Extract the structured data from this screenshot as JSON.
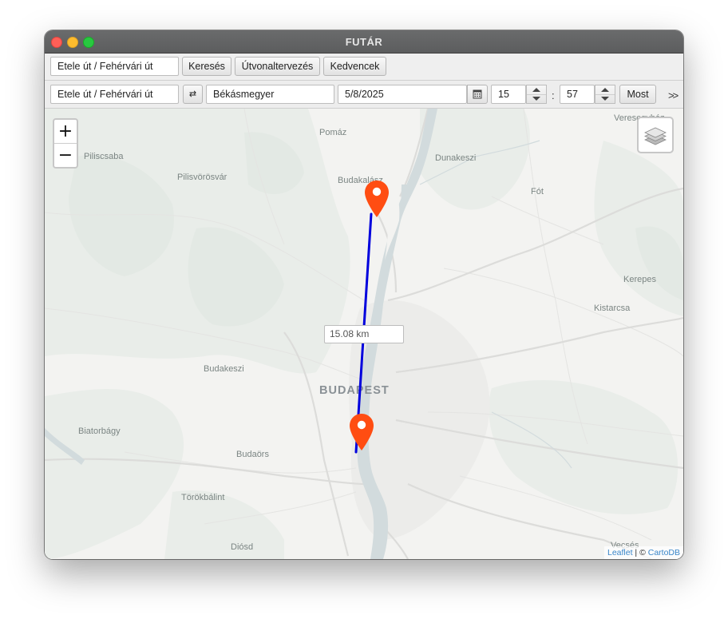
{
  "window": {
    "title": "FUTÁR"
  },
  "toolbar1": {
    "search_value": "Etele út / Fehérvári út",
    "search_button": "Keresés",
    "route_button": "Útvonaltervezés",
    "favorites_button": "Kedvencek"
  },
  "toolbar2": {
    "from_value": "Etele út / Fehérvári út",
    "swap_label": "⇄",
    "to_value": "Békásmegyer",
    "date_value": "5/8/2025",
    "hour_value": "15",
    "minute_value": "57",
    "time_separator": ":",
    "now_button": "Most",
    "more_label": ">>"
  },
  "map": {
    "places": [
      "Veresegyház",
      "Pomáz",
      "Piliscsaba",
      "Dunakeszi",
      "Pilisvörösvár",
      "Budakalász",
      "Fót",
      "Kerepes",
      "Kistarcsa",
      "Budakeszi",
      "Biatorbágy",
      "Budaörs",
      "Törökbálint",
      "Diósd",
      "Vecsés"
    ],
    "city_label": "BUDAPEST",
    "distance_label": "15.08 km",
    "zoom_in": "+",
    "zoom_out": "−",
    "attribution": {
      "leaflet": "Leaflet",
      "separator": " | © ",
      "provider": "CartoDB"
    },
    "route_color": "#0000dd",
    "marker_color": "#ff4d12"
  }
}
